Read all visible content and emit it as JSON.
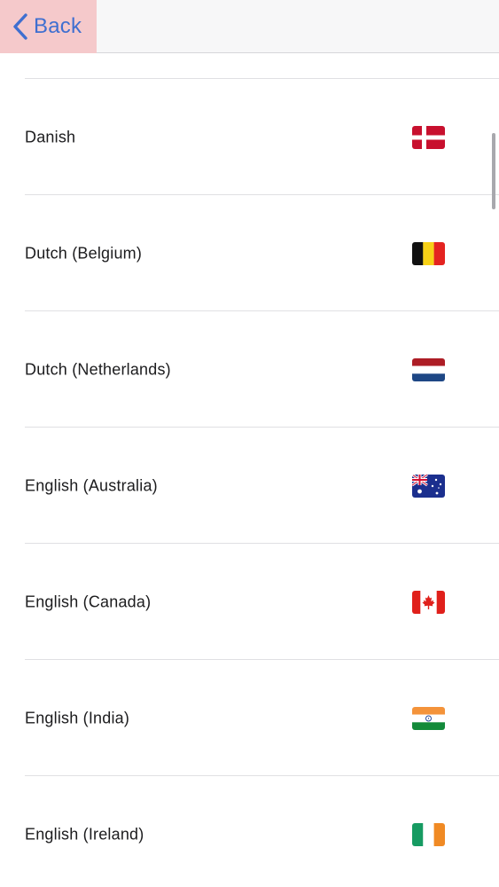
{
  "navbar": {
    "back_label": "Back",
    "accent_color": "#3f6fd0"
  },
  "languages": [
    {
      "label": "Danish",
      "flag": "denmark-flag"
    },
    {
      "label": "Dutch (Belgium)",
      "flag": "belgium-flag"
    },
    {
      "label": "Dutch (Netherlands)",
      "flag": "netherlands-flag"
    },
    {
      "label": "English (Australia)",
      "flag": "australia-flag"
    },
    {
      "label": "English (Canada)",
      "flag": "canada-flag"
    },
    {
      "label": "English (India)",
      "flag": "india-flag"
    },
    {
      "label": "English (Ireland)",
      "flag": "ireland-flag"
    }
  ]
}
